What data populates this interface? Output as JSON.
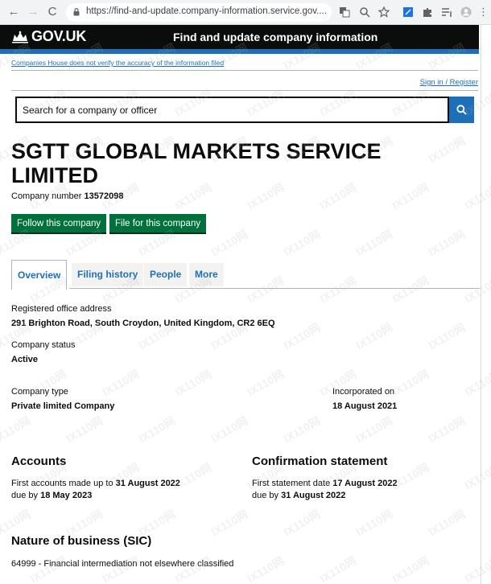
{
  "browser": {
    "url": "https://find-and-update.company-information.service.gov....",
    "nav": {
      "back": "←",
      "forward": "→",
      "reload": "C"
    }
  },
  "header": {
    "logo_text": "GOV.UK",
    "service_name": "Find and update company information"
  },
  "banner_link": "Companies House does not verify the accuracy of the information filed",
  "sign_in": "Sign in / Register",
  "search": {
    "placeholder": "Search for a company or officer"
  },
  "company": {
    "name_line1": "SGTT GLOBAL MARKETS SERVICE",
    "name_line2": "LIMITED",
    "number_label": "Company number",
    "number": "13572098"
  },
  "actions": {
    "follow": "Follow this company",
    "file": "File for this company"
  },
  "tabs": [
    "Overview",
    "Filing history",
    "People",
    "More"
  ],
  "overview": {
    "registered_office_label": "Registered office address",
    "registered_office_value": "291 Brighton Road, South Croydon, United Kingdom, CR2 6EQ",
    "status_label": "Company status",
    "status_value": "Active",
    "type_label": "Company type",
    "type_value": "Private limited Company",
    "incorporated_label": "Incorporated on",
    "incorporated_value": "18 August 2021"
  },
  "accounts": {
    "title": "Accounts",
    "line1_prefix": "First accounts made up to",
    "line1_date": "31 August 2022",
    "line2_prefix": "due by",
    "line2_date": "18 May 2023"
  },
  "confirmation": {
    "title": "Confirmation statement",
    "line1_prefix": "First statement date",
    "line1_date": "17 August 2022",
    "line2_prefix": "due by",
    "line2_date": "31 August 2022"
  },
  "sic": {
    "title": "Nature of business (SIC)",
    "entry": "64999 - Financial intermediation not elsewhere classified"
  },
  "watermark_text": "IX110网",
  "colors": {
    "header_bg": "#0b0c0c",
    "link": "#1d70b8",
    "button_green": "#00703c",
    "search_button": "#1d70b8"
  }
}
